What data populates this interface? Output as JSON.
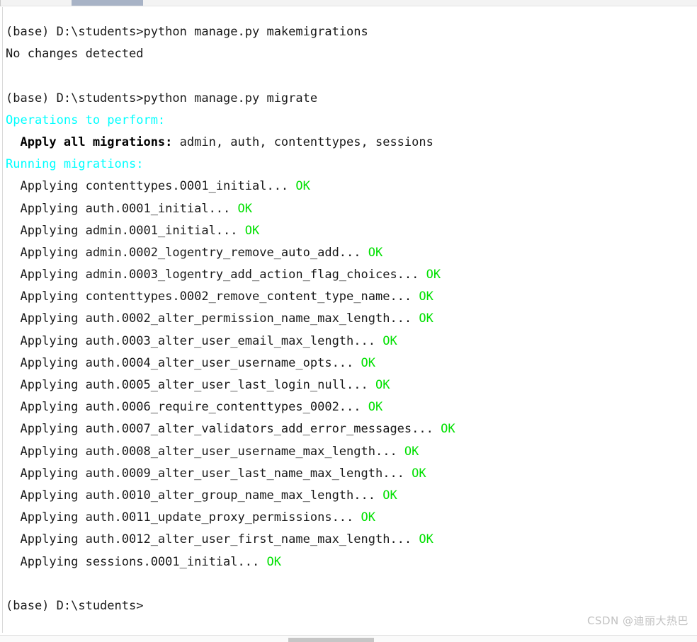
{
  "window": {
    "background_color": "#ffffff",
    "text_color": "#1a1a1a",
    "cyan_color": "#00ffff",
    "green_color": "#00e000"
  },
  "scrollbars": {
    "top_thumb_label": "horizontal-scrollbar-thumb-top",
    "bottom_thumb_label": "horizontal-scrollbar-thumb-bottom"
  },
  "terminal": {
    "prompt": "(base) D:\\students>",
    "lines": [
      {
        "id": 0,
        "segments": [
          {
            "text": "(base) D:\\students>python manage.py makemigrations",
            "style": "default"
          }
        ]
      },
      {
        "id": 1,
        "segments": [
          {
            "text": "No changes detected",
            "style": "default"
          }
        ]
      },
      {
        "id": 2,
        "segments": [
          {
            "text": "",
            "style": "default"
          }
        ]
      },
      {
        "id": 3,
        "segments": [
          {
            "text": "(base) D:\\students>python manage.py migrate",
            "style": "default"
          }
        ]
      },
      {
        "id": 4,
        "segments": [
          {
            "text": "Operations to perform:",
            "style": "cyan"
          }
        ]
      },
      {
        "id": 5,
        "segments": [
          {
            "text": "  Apply all migrations:",
            "style": "bold"
          },
          {
            "text": " admin, auth, contenttypes, sessions",
            "style": "default"
          }
        ]
      },
      {
        "id": 6,
        "segments": [
          {
            "text": "Running migrations:",
            "style": "cyan"
          }
        ]
      },
      {
        "id": 7,
        "segments": [
          {
            "text": "  Applying contenttypes.0001_initial... ",
            "style": "default"
          },
          {
            "text": "OK",
            "style": "green"
          }
        ]
      },
      {
        "id": 8,
        "segments": [
          {
            "text": "  Applying auth.0001_initial... ",
            "style": "default"
          },
          {
            "text": "OK",
            "style": "green"
          }
        ]
      },
      {
        "id": 9,
        "segments": [
          {
            "text": "  Applying admin.0001_initial... ",
            "style": "default"
          },
          {
            "text": "OK",
            "style": "green"
          }
        ]
      },
      {
        "id": 10,
        "segments": [
          {
            "text": "  Applying admin.0002_logentry_remove_auto_add... ",
            "style": "default"
          },
          {
            "text": "OK",
            "style": "green"
          }
        ]
      },
      {
        "id": 11,
        "segments": [
          {
            "text": "  Applying admin.0003_logentry_add_action_flag_choices... ",
            "style": "default"
          },
          {
            "text": "OK",
            "style": "green"
          }
        ]
      },
      {
        "id": 12,
        "segments": [
          {
            "text": "  Applying contenttypes.0002_remove_content_type_name... ",
            "style": "default"
          },
          {
            "text": "OK",
            "style": "green"
          }
        ]
      },
      {
        "id": 13,
        "segments": [
          {
            "text": "  Applying auth.0002_alter_permission_name_max_length... ",
            "style": "default"
          },
          {
            "text": "OK",
            "style": "green"
          }
        ]
      },
      {
        "id": 14,
        "segments": [
          {
            "text": "  Applying auth.0003_alter_user_email_max_length... ",
            "style": "default"
          },
          {
            "text": "OK",
            "style": "green"
          }
        ]
      },
      {
        "id": 15,
        "segments": [
          {
            "text": "  Applying auth.0004_alter_user_username_opts... ",
            "style": "default"
          },
          {
            "text": "OK",
            "style": "green"
          }
        ]
      },
      {
        "id": 16,
        "segments": [
          {
            "text": "  Applying auth.0005_alter_user_last_login_null... ",
            "style": "default"
          },
          {
            "text": "OK",
            "style": "green"
          }
        ]
      },
      {
        "id": 17,
        "segments": [
          {
            "text": "  Applying auth.0006_require_contenttypes_0002... ",
            "style": "default"
          },
          {
            "text": "OK",
            "style": "green"
          }
        ]
      },
      {
        "id": 18,
        "segments": [
          {
            "text": "  Applying auth.0007_alter_validators_add_error_messages... ",
            "style": "default"
          },
          {
            "text": "OK",
            "style": "green"
          }
        ]
      },
      {
        "id": 19,
        "segments": [
          {
            "text": "  Applying auth.0008_alter_user_username_max_length... ",
            "style": "default"
          },
          {
            "text": "OK",
            "style": "green"
          }
        ]
      },
      {
        "id": 20,
        "segments": [
          {
            "text": "  Applying auth.0009_alter_user_last_name_max_length... ",
            "style": "default"
          },
          {
            "text": "OK",
            "style": "green"
          }
        ]
      },
      {
        "id": 21,
        "segments": [
          {
            "text": "  Applying auth.0010_alter_group_name_max_length... ",
            "style": "default"
          },
          {
            "text": "OK",
            "style": "green"
          }
        ]
      },
      {
        "id": 22,
        "segments": [
          {
            "text": "  Applying auth.0011_update_proxy_permissions... ",
            "style": "default"
          },
          {
            "text": "OK",
            "style": "green"
          }
        ]
      },
      {
        "id": 23,
        "segments": [
          {
            "text": "  Applying auth.0012_alter_user_first_name_max_length... ",
            "style": "default"
          },
          {
            "text": "OK",
            "style": "green"
          }
        ]
      },
      {
        "id": 24,
        "segments": [
          {
            "text": "  Applying sessions.0001_initial... ",
            "style": "default"
          },
          {
            "text": "OK",
            "style": "green"
          }
        ]
      },
      {
        "id": 25,
        "segments": [
          {
            "text": "",
            "style": "default"
          }
        ]
      },
      {
        "id": 26,
        "segments": [
          {
            "text": "(base) D:\\students>",
            "style": "default"
          }
        ]
      }
    ]
  },
  "watermark": {
    "text": "CSDN @迪丽大热巴"
  }
}
